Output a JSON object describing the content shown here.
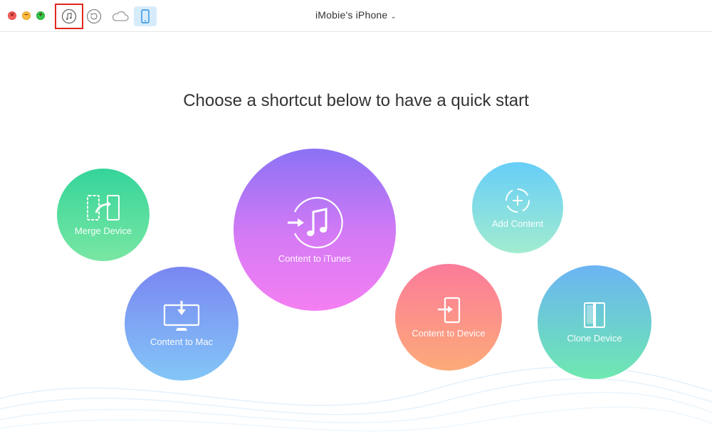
{
  "window": {
    "device_name": "iMobie's iPhone",
    "controls": {
      "close": "×",
      "minimize": "−",
      "maximize": "+"
    }
  },
  "toolbar": {
    "icons": [
      "itunes-icon",
      "restore-icon",
      "cloud-icon",
      "device-icon"
    ],
    "selected": "device-icon",
    "highlight_color": "#e0281c"
  },
  "main": {
    "headline": "Choose a shortcut below to have a quick start",
    "shortcuts": [
      {
        "label": "Merge Device",
        "icon": "merge-device-icon"
      },
      {
        "label": "Content to Mac",
        "icon": "content-to-mac-icon"
      },
      {
        "label": "Content to iTunes",
        "icon": "content-to-itunes-icon"
      },
      {
        "label": "Add Content",
        "icon": "add-content-icon"
      },
      {
        "label": "Content to Device",
        "icon": "content-to-device-icon"
      },
      {
        "label": "Clone Device",
        "icon": "clone-device-icon"
      }
    ]
  },
  "colors": {
    "merge": [
      "#35d49a",
      "#79e7a3"
    ],
    "mac": [
      "#7a86f2",
      "#83c6f7"
    ],
    "itunes": [
      "#8b72f5",
      "#f47ff2"
    ],
    "add": [
      "#67cef8",
      "#a2eccf"
    ],
    "to_device": [
      "#fb7b9a",
      "#fdaa79"
    ],
    "clone": [
      "#6bb4f3",
      "#6ee8b0"
    ]
  }
}
